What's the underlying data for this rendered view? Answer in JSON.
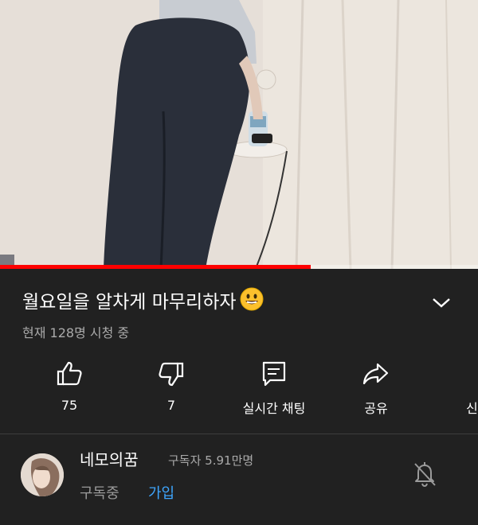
{
  "video": {
    "progress_fraction": 0.65,
    "title": "월요일을 알차게 마무리하자",
    "title_emoji": "smiling-face-emoji",
    "viewers": "현재 128명 시청 중"
  },
  "actions": [
    {
      "name": "like",
      "icon": "thumbs-up-icon",
      "label": "75"
    },
    {
      "name": "dislike",
      "icon": "thumbs-down-icon",
      "label": "7"
    },
    {
      "name": "live-chat",
      "icon": "chat-icon",
      "label": "실시간 채팅"
    },
    {
      "name": "share",
      "icon": "share-icon",
      "label": "공유"
    },
    {
      "name": "save",
      "icon": "save-icon",
      "label": "신"
    }
  ],
  "channel": {
    "name": "네모의꿈",
    "subscribers": "구독자 5.91만명",
    "subscribed_label": "구독중",
    "join_label": "가입",
    "bell_icon": "notifications-off-icon"
  },
  "colors": {
    "background": "#212121",
    "progress": "#ff0000",
    "join": "#3ea6ff",
    "secondary_text": "#aaaaaa"
  }
}
